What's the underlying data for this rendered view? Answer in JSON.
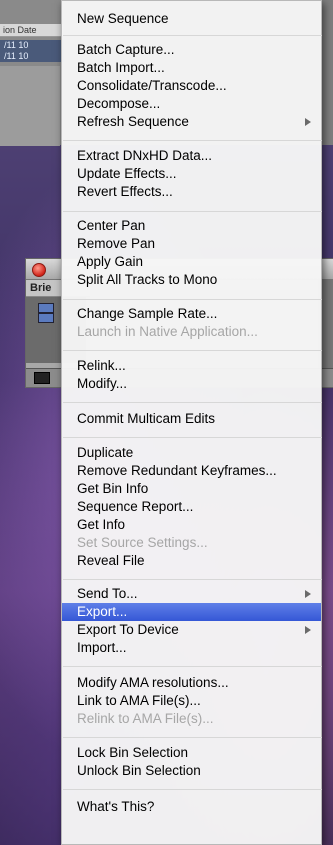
{
  "background_window": {
    "column_header": "ion Date",
    "rows": [
      "/11 10",
      "/11 10"
    ]
  },
  "bin_window": {
    "tab_label": "Brie"
  },
  "menu": {
    "new_sequence": "New Sequence",
    "batch_capture": "Batch Capture...",
    "batch_import": "Batch Import...",
    "consolidate_transcode": "Consolidate/Transcode...",
    "decompose": "Decompose...",
    "refresh_sequence": "Refresh Sequence",
    "extract_dnxhd": "Extract DNxHD Data...",
    "update_effects": "Update Effects...",
    "revert_effects": "Revert Effects...",
    "center_pan": "Center Pan",
    "remove_pan": "Remove Pan",
    "apply_gain": "Apply Gain",
    "split_tracks_mono": "Split All Tracks to Mono",
    "change_sample_rate": "Change Sample Rate...",
    "launch_native": "Launch in Native Application...",
    "relink": "Relink...",
    "modify": "Modify...",
    "commit_multicam": "Commit Multicam Edits",
    "duplicate": "Duplicate",
    "remove_redundant_keyframes": "Remove Redundant Keyframes...",
    "get_bin_info": "Get Bin Info",
    "sequence_report": "Sequence Report...",
    "get_info": "Get Info",
    "set_source_settings": "Set Source Settings...",
    "reveal_file": "Reveal File",
    "send_to": "Send To...",
    "export": "Export...",
    "export_to_device": "Export To Device",
    "import": "Import...",
    "modify_ama": "Modify AMA resolutions...",
    "link_ama": "Link to AMA File(s)...",
    "relink_ama": "Relink to AMA File(s)...",
    "lock_bin": "Lock Bin Selection",
    "unlock_bin": "Unlock Bin Selection",
    "whats_this": "What's This?"
  },
  "colors": {
    "selection_highlight": "#3f62dc",
    "disabled_text": "#a6a6a6",
    "close_button": "#d2241a"
  }
}
